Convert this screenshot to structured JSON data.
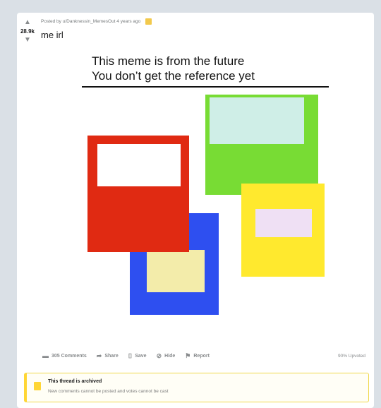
{
  "post": {
    "score": "28.9k",
    "meta": "Posted by u/Danknessin_MemesOut 4 years ago",
    "title": "me irl"
  },
  "meme": {
    "line1": "This meme is from the future",
    "line2": "You don’t get the reference yet",
    "colors": {
      "red": "#e02a12",
      "blue": "#2e4ff0",
      "green": "#78dc34",
      "yellow": "#ffe92e",
      "red_inner": "#ffffff",
      "blue_inner": "#f3ecaa",
      "green_inner": "#cfeee7",
      "yellow_inner": "#efe0f4"
    }
  },
  "actions": {
    "comments": "305 Comments",
    "share": "Share",
    "save": "Save",
    "hide": "Hide",
    "report": "Report",
    "upvoted": "90% Upvoted"
  },
  "archived": {
    "title": "This thread is archived",
    "subtitle": "New comments cannot be posted and votes cannot be cast"
  }
}
